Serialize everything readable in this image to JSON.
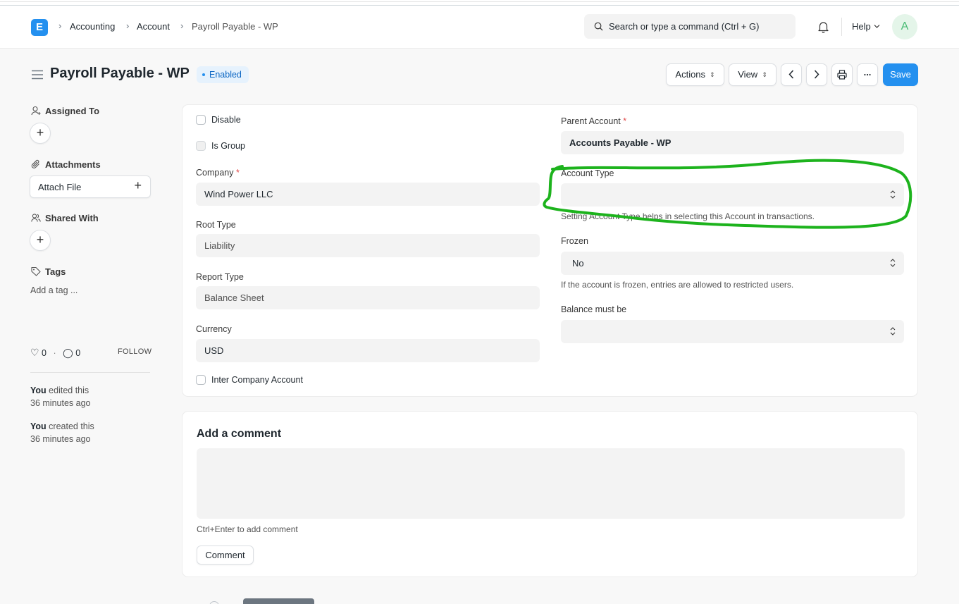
{
  "navbar": {
    "logo_letter": "E",
    "breadcrumbs": [
      "Accounting",
      "Account",
      "Payroll Payable - WP"
    ],
    "search_placeholder": "Search or type a command (Ctrl + G)",
    "help_label": "Help",
    "avatar_initial": "A"
  },
  "header": {
    "title": "Payroll Payable - WP",
    "status": "Enabled",
    "actions_label": "Actions",
    "view_label": "View",
    "more_label": "...",
    "save_label": "Save"
  },
  "sidebar": {
    "assigned_to": "Assigned To",
    "attachments": "Attachments",
    "attach_file": "Attach File",
    "shared_with": "Shared With",
    "tags": "Tags",
    "add_tag": "Add a tag ...",
    "likes": "0",
    "comments": "0",
    "follow": "FOLLOW",
    "activity": [
      {
        "who": "You",
        "what": " edited this",
        "when": "36 minutes ago"
      },
      {
        "who": "You",
        "what": " created this",
        "when": "36 minutes ago"
      }
    ]
  },
  "form": {
    "disable_label": "Disable",
    "is_group_label": "Is Group",
    "company_label": "Company",
    "company_value": "Wind Power LLC",
    "root_type_label": "Root Type",
    "root_type_value": "Liability",
    "report_type_label": "Report Type",
    "report_type_value": "Balance Sheet",
    "currency_label": "Currency",
    "currency_value": "USD",
    "inter_company_label": "Inter Company Account",
    "parent_account_label": "Parent Account",
    "parent_account_value": "Accounts Payable - WP",
    "account_type_label": "Account Type",
    "account_type_value": "",
    "account_type_desc": "Setting Account Type helps in selecting this Account in transactions.",
    "frozen_label": "Frozen",
    "frozen_value": "No",
    "frozen_desc": "If the account is frozen, entries are allowed to restricted users.",
    "balance_label": "Balance must be",
    "balance_value": "",
    "required_mark": "*"
  },
  "comment": {
    "title": "Add a comment",
    "hint": "Ctrl+Enter to add comment",
    "button": "Comment"
  },
  "colors": {
    "primary": "#2490ef",
    "annotation": "#1db31d"
  }
}
